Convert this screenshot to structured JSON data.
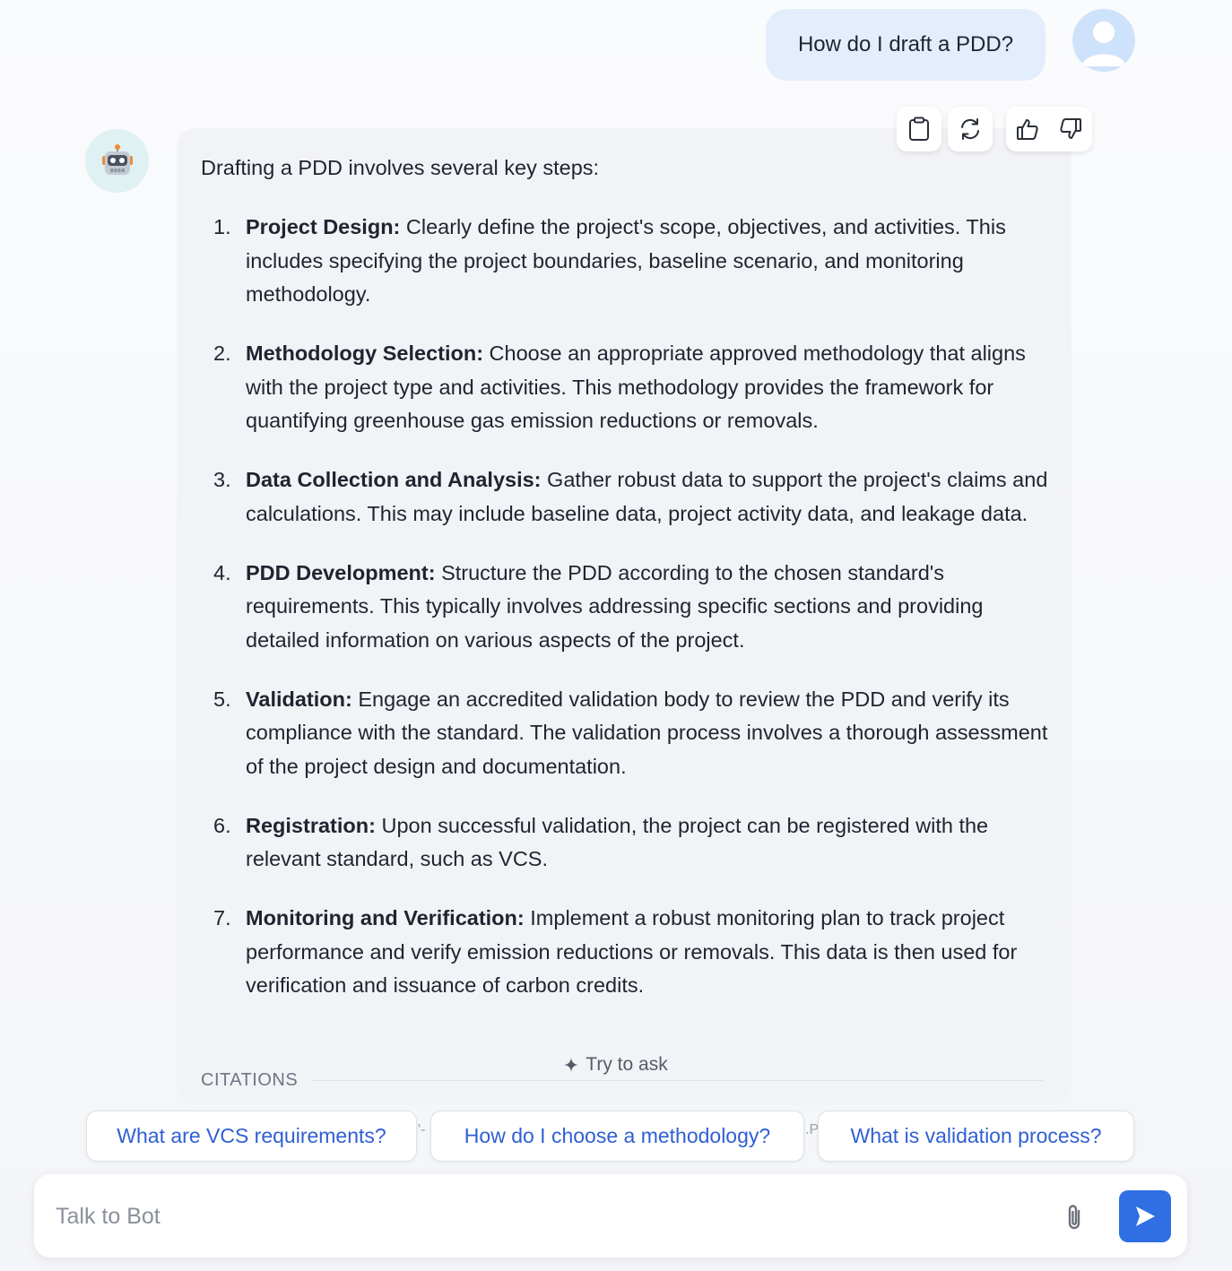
{
  "user_message": {
    "text": "How do I draft a PDD?"
  },
  "bot_message": {
    "intro": "Drafting a PDD involves several key steps:",
    "steps": [
      {
        "num": "1.",
        "title": "Project Design:",
        "body": " Clearly define the project's scope, objectives, and activities. This includes specifying the project boundaries, baseline scenario, and monitoring methodology."
      },
      {
        "num": "2.",
        "title": "Methodology Selection:",
        "body": " Choose an appropriate approved methodology that aligns with the project type and activities. This methodology provides the framework for quantifying greenhouse gas emission reductions or removals."
      },
      {
        "num": "3.",
        "title": "Data Collection and Analysis:",
        "body": " Gather robust data to support the project's claims and calculations. This may include baseline data, project activity data, and leakage data."
      },
      {
        "num": "4.",
        "title": "PDD Development:",
        "body": " Structure the PDD according to the chosen standard's requirements. This typically involves addressing specific sections and providing detailed information on various aspects of the project."
      },
      {
        "num": "5.",
        "title": "Validation:",
        "body": " Engage an accredited validation body to review the PDD and verify its compliance with the standard. The validation process involves a thorough assessment of the project design and documentation."
      },
      {
        "num": "6.",
        "title": "Registration:",
        "body": " Upon successful validation, the project can be registered with the relevant standard, such as VCS."
      },
      {
        "num": "7.",
        "title": "Monitoring and Verification:",
        "body": " Implement a robust monitoring plan to track project performance and verify emission reductions or removals. This data is then used for verification and issuance of carbon credits."
      }
    ],
    "citations_label": "CITATIONS"
  },
  "toolbar": {
    "icons": [
      "clipboard-icon",
      "refresh-icon",
      "thumbs-up-icon",
      "thumbs-down-icon"
    ]
  },
  "try_to_ask": {
    "label": "Try to ask",
    "icon": "sparkle-icon"
  },
  "suggestions": [
    {
      "label": "What are VCS requirements?"
    },
    {
      "label": "How do I choose a methodology?"
    },
    {
      "label": "What is validation process?"
    }
  ],
  "suggestion_peeks": [
    "'-",
    ".P"
  ],
  "composer": {
    "placeholder": "Talk to Bot",
    "icons": [
      "paperclip-icon",
      "send-icon"
    ],
    "send_color": "#2f6fe3"
  },
  "colors": {
    "user_bubble": "#e3edfb",
    "bot_bubble": "#f2f3f6",
    "link": "#2f5fd3",
    "accent": "#2f6fe3"
  }
}
